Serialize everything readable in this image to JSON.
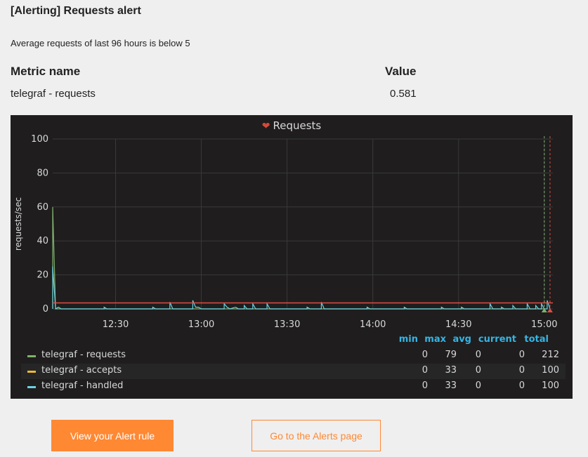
{
  "alert": {
    "title": "[Alerting] Requests alert",
    "message": "Average requests of last 96 hours is below 5",
    "col_metric": "Metric name",
    "col_value": "Value",
    "metric_name": "telegraf - requests",
    "metric_value": "0.581"
  },
  "panel": {
    "title": "Requests",
    "status_icon": "broken-heart-icon",
    "legend": {
      "headers": [
        "min",
        "max",
        "avg",
        "current",
        "total"
      ],
      "rows": [
        {
          "name": "telegraf - requests",
          "color": "#7eb26d",
          "min": "0",
          "max": "79",
          "avg": "0",
          "current": "0",
          "total": "212"
        },
        {
          "name": "telegraf - accepts",
          "color": "#eab839",
          "min": "0",
          "max": "33",
          "avg": "0",
          "current": "0",
          "total": "100"
        },
        {
          "name": "telegraf - handled",
          "color": "#6ed0e0",
          "min": "0",
          "max": "33",
          "avg": "0",
          "current": "0",
          "total": "100"
        }
      ]
    }
  },
  "buttons": {
    "view_rule": "View your Alert rule",
    "alerts_page": "Go to the Alerts page"
  },
  "chart_data": {
    "type": "line",
    "title": "Requests",
    "xlabel": "",
    "ylabel": "requests/sec",
    "ylim": [
      0,
      100
    ],
    "yticks": [
      0,
      20,
      40,
      60,
      80,
      100
    ],
    "xticks": [
      "12:30",
      "13:00",
      "13:30",
      "14:00",
      "14:30",
      "15:00"
    ],
    "x_range": [
      "12:08",
      "15:03"
    ],
    "grid": true,
    "threshold": 3.5,
    "series": [
      {
        "name": "telegraf - requests",
        "color": "#7eb26d",
        "points": [
          [
            "12:08",
            0
          ],
          [
            "12:08",
            60
          ],
          [
            "12:09",
            0
          ],
          [
            "14:59",
            0
          ],
          [
            "15:00",
            0
          ]
        ]
      },
      {
        "name": "telegraf - handled",
        "color": "#6ed0e0",
        "points": [
          [
            "12:08",
            0
          ],
          [
            "12:08",
            25
          ],
          [
            "12:09",
            0
          ],
          [
            "12:10",
            1
          ],
          [
            "12:11",
            0
          ],
          [
            "12:26",
            0
          ],
          [
            "12:26",
            1
          ],
          [
            "12:27",
            0
          ],
          [
            "12:43",
            0
          ],
          [
            "12:43",
            1
          ],
          [
            "12:44",
            0
          ],
          [
            "12:49",
            0
          ],
          [
            "12:49",
            4
          ],
          [
            "12:50",
            0
          ],
          [
            "12:57",
            0
          ],
          [
            "12:57",
            5
          ],
          [
            "12:58",
            1
          ],
          [
            "12:59",
            1
          ],
          [
            "13:00",
            0
          ],
          [
            "13:08",
            0
          ],
          [
            "13:08",
            3
          ],
          [
            "13:09",
            1
          ],
          [
            "13:10",
            0
          ],
          [
            "13:12",
            1
          ],
          [
            "13:13",
            0
          ],
          [
            "13:15",
            0
          ],
          [
            "13:15",
            2
          ],
          [
            "13:16",
            0
          ],
          [
            "13:18",
            0
          ],
          [
            "13:18",
            3
          ],
          [
            "13:19",
            0
          ],
          [
            "13:23",
            0
          ],
          [
            "13:23",
            3
          ],
          [
            "13:24",
            0
          ],
          [
            "13:37",
            0
          ],
          [
            "13:37",
            1
          ],
          [
            "13:38",
            0
          ],
          [
            "13:42",
            0
          ],
          [
            "13:42",
            4
          ],
          [
            "13:43",
            0
          ],
          [
            "13:58",
            0
          ],
          [
            "13:58",
            1
          ],
          [
            "13:59",
            0
          ],
          [
            "14:11",
            0
          ],
          [
            "14:11",
            1
          ],
          [
            "14:12",
            0
          ],
          [
            "14:24",
            0
          ],
          [
            "14:24",
            1
          ],
          [
            "14:25",
            0
          ],
          [
            "14:31",
            0
          ],
          [
            "14:31",
            1
          ],
          [
            "14:32",
            0
          ],
          [
            "14:41",
            0
          ],
          [
            "14:41",
            3
          ],
          [
            "14:42",
            0
          ],
          [
            "14:45",
            0
          ],
          [
            "14:45",
            1
          ],
          [
            "14:46",
            0
          ],
          [
            "14:49",
            0
          ],
          [
            "14:49",
            2
          ],
          [
            "14:50",
            0
          ],
          [
            "14:54",
            0
          ],
          [
            "14:54",
            3
          ],
          [
            "14:55",
            0
          ],
          [
            "14:57",
            0
          ],
          [
            "14:57",
            2
          ],
          [
            "14:58",
            0
          ],
          [
            "14:59",
            0
          ],
          [
            "14:59",
            3
          ],
          [
            "15:00",
            0
          ],
          [
            "15:01",
            0
          ],
          [
            "15:01",
            5
          ],
          [
            "15:02",
            0
          ]
        ]
      }
    ],
    "annotations": [
      {
        "time": "15:00",
        "color": "#7eb26d",
        "type": "ok"
      },
      {
        "time": "15:02",
        "color": "#e24d42",
        "type": "alerting"
      }
    ]
  }
}
